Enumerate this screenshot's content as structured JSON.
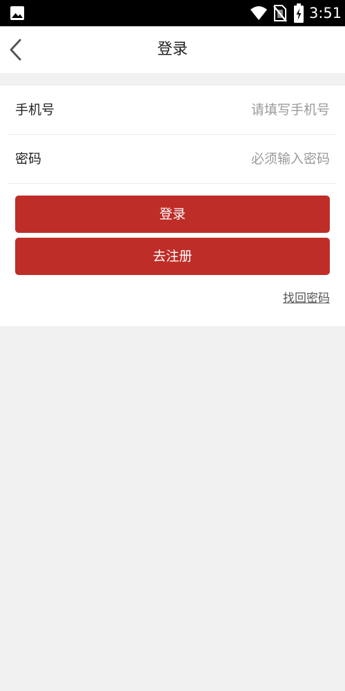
{
  "status_bar": {
    "time": "3:51",
    "icons": [
      "gallery-icon",
      "wifi-icon",
      "no-sim-icon",
      "battery-charging-icon"
    ]
  },
  "nav": {
    "title": "登录",
    "back_icon": "chevron-left-icon"
  },
  "form": {
    "phone": {
      "label": "手机号",
      "placeholder": "请填写手机号",
      "value": ""
    },
    "password": {
      "label": "密码",
      "placeholder": "必须输入密码",
      "value": ""
    }
  },
  "actions": {
    "login_label": "登录",
    "register_label": "去注册",
    "forgot_label": "找回密码"
  },
  "colors": {
    "primary_button": "#bf2d28",
    "page_background": "#f1f1f1",
    "card_background": "#ffffff",
    "status_bar": "#000000"
  }
}
